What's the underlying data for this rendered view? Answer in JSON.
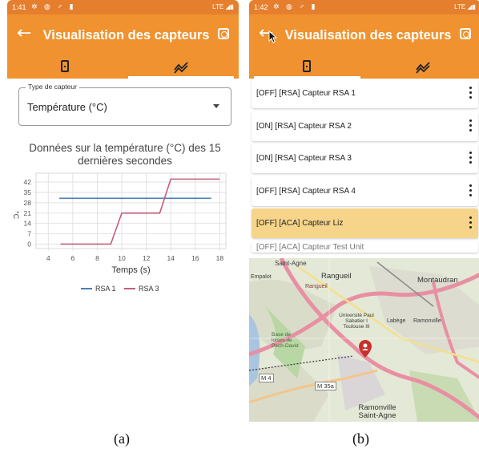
{
  "panel_a": {
    "status": {
      "time": "1:41",
      "right": "LTE"
    },
    "appbar": {
      "title": "Visualisation des capteurs"
    },
    "select": {
      "label": "Type de capteur",
      "value": "Température (°C)"
    },
    "chart_title": "Données sur la température (°C) des 15 dernières secondes",
    "caption": "(a)"
  },
  "panel_b": {
    "status": {
      "time": "1:42",
      "right": "LTE"
    },
    "appbar": {
      "title": "Visualisation des capteurs"
    },
    "sensors": [
      {
        "label": "[OFF] [RSA] Capteur RSA 1",
        "highlighted": false
      },
      {
        "label": "[ON] [RSA] Capteur RSA 2",
        "highlighted": false
      },
      {
        "label": "[ON] [RSA] Capteur RSA 3",
        "highlighted": false
      },
      {
        "label": "[OFF] [RSA] Capteur RSA 4",
        "highlighted": false
      },
      {
        "label": "[OFF] [ACA] Capteur Liz",
        "highlighted": true
      }
    ],
    "sensor_partial": "[OFF] [ACA] Capteur Test Unit",
    "map_labels": {
      "saint_agne_top": "Saint-Agne",
      "rangueil": "Rangueil",
      "montaudran": "Montaudran",
      "labege": "Labège",
      "ramonville_top": "Ramonville",
      "universite": "Université Paul Sabatier I Toulouse III",
      "base_loisirs": "Base de loisirs de Pech-David",
      "empalot": "Empalot",
      "m4": "M 4",
      "m35a": "M 35a",
      "ramonville_bottom": "Ramonville Saint-Agne",
      "rangueil_road": "Rangueil"
    },
    "caption": "(b)"
  },
  "colors": {
    "appbar": "#f0922f",
    "statusbar": "#e57f2d",
    "rsa1": "#4a7fb5",
    "rsa3": "#c0607a",
    "highlight": "#f6d58a"
  },
  "chart_data": {
    "type": "line",
    "title": "Données sur la température (°C) des 15 dernières secondes",
    "xlabel": "Temps (s)",
    "ylabel": "°C",
    "xlim": [
      3,
      18.5
    ],
    "ylim": [
      -3,
      48
    ],
    "xticks": [
      4,
      6,
      8,
      10,
      12,
      14,
      16,
      18
    ],
    "yticks": [
      0,
      7,
      14,
      21,
      28,
      35,
      42
    ],
    "series": [
      {
        "name": "RSA 1",
        "color": "#4a7fb5",
        "x": [
          4.9,
          17.3
        ],
        "y": [
          31,
          31
        ]
      },
      {
        "name": "RSA 3",
        "color": "#c0607a",
        "x": [
          5.0,
          9.1,
          10.0,
          13.1,
          14.0,
          18.0
        ],
        "y": [
          0,
          0,
          21,
          21,
          44,
          44
        ]
      }
    ],
    "legend": "bottom",
    "grid": true
  }
}
